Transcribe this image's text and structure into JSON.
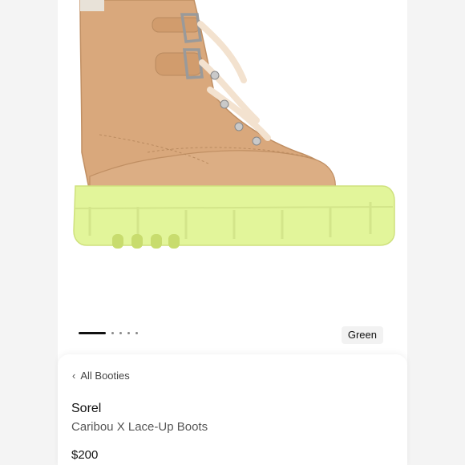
{
  "carousel": {
    "color_label": "Green",
    "dot_count": 5,
    "active_index": 0
  },
  "breadcrumb": {
    "label": "All Booties",
    "icon": "chevron-left-icon"
  },
  "product": {
    "brand": "Sorel",
    "name": "Caribou X Lace-Up Boots",
    "price": "$200"
  },
  "colors": {
    "leather": "#d7a67a",
    "sole": "#e2f59a",
    "laces": "#f3e2cf"
  }
}
